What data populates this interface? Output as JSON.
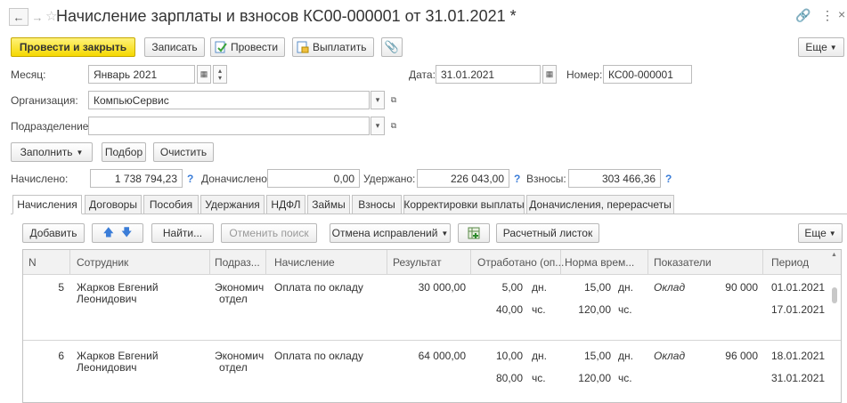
{
  "window": {
    "title": "Начисление зарплаты и взносов КС00-000001 от 31.01.2021 *",
    "more_label": "⋮",
    "close_label": "×"
  },
  "toolbar": {
    "post_close": "Провести и закрыть",
    "write": "Записать",
    "post": "Провести",
    "pay": "Выплатить",
    "more": "Еще"
  },
  "form": {
    "month_label": "Месяц:",
    "month_value": "Январь 2021",
    "date_label": "Дата:",
    "date_value": "31.01.2021",
    "number_label": "Номер:",
    "number_value": "КС00-000001",
    "org_label": "Организация:",
    "org_value": "КомпьюСервис",
    "dept_label": "Подразделение:",
    "dept_value": ""
  },
  "actions": {
    "fill": "Заполнить",
    "pick": "Подбор",
    "clear": "Очистить"
  },
  "totals": {
    "accrued_label": "Начислено:",
    "accrued_value": "1 738 794,23",
    "extra_label": "Доначислено:",
    "extra_value": "0,00",
    "withheld_label": "Удержано:",
    "withheld_value": "226 043,00",
    "contrib_label": "Взносы:",
    "contrib_value": "303 466,36",
    "q": "?"
  },
  "tabs": [
    "Начисления",
    "Договоры",
    "Пособия",
    "Удержания",
    "НДФЛ",
    "Займы",
    "Взносы",
    "Корректировки выплаты",
    "Доначисления, перерасчеты"
  ],
  "grid_toolbar": {
    "add": "Добавить",
    "find": "Найти...",
    "cancel_search": "Отменить поиск",
    "cancel_fix": "Отмена исправлений",
    "payslip": "Расчетный листок",
    "more": "Еще"
  },
  "columns": [
    "N",
    "Сотрудник",
    "Подраз...",
    "Начисление",
    "Результат",
    "Отработано (оп...",
    "Норма врем...",
    "Показатели",
    "Период"
  ],
  "rows": [
    {
      "n": "5",
      "employee_1": "Жарков Евгений",
      "employee_2": "Леонидович",
      "dept_1": "Экономич",
      "dept_2": "отдел",
      "accrual": "Оплата по окладу",
      "result": "30 000,00",
      "worked_days": "5,00",
      "worked_days_unit": "дн.",
      "worked_hours": "40,00",
      "worked_hours_unit": "чс.",
      "norm_days": "15,00",
      "norm_days_unit": "дн.",
      "norm_hours": "120,00",
      "norm_hours_unit": "чс.",
      "indicator": "Оклад",
      "indicator_value": "90 000",
      "period_from": "01.01.2021",
      "period_to": "17.01.2021"
    },
    {
      "n": "6",
      "employee_1": "Жарков Евгений",
      "employee_2": "Леонидович",
      "dept_1": "Экономич",
      "dept_2": "отдел",
      "accrual": "Оплата по окладу",
      "result": "64 000,00",
      "worked_days": "10,00",
      "worked_days_unit": "дн.",
      "worked_hours": "80,00",
      "worked_hours_unit": "чс.",
      "norm_days": "15,00",
      "norm_days_unit": "дн.",
      "norm_hours": "120,00",
      "norm_hours_unit": "чс.",
      "indicator": "Оклад",
      "indicator_value": "96 000",
      "period_from": "18.01.2021",
      "period_to": "31.01.2021"
    }
  ]
}
